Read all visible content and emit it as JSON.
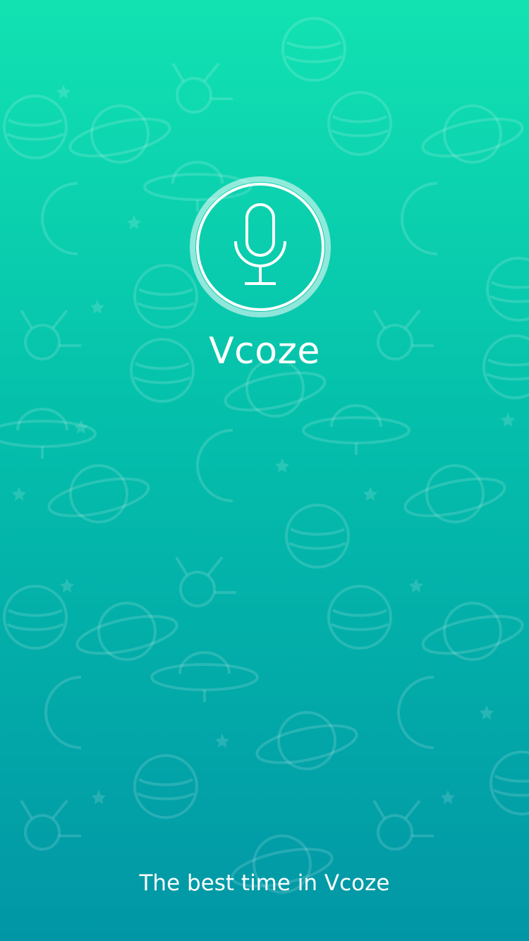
{
  "splash": {
    "app_name": "Vcoze",
    "tagline": "The best time in Vcoze",
    "logo_icon": "microphone-icon",
    "background_pattern": "space-doodle-pattern",
    "colors": {
      "gradient_top": "#12e2b2",
      "gradient_middle": "#04bfab",
      "gradient_bottom": "#0196a6",
      "text": "#ffffff"
    }
  }
}
